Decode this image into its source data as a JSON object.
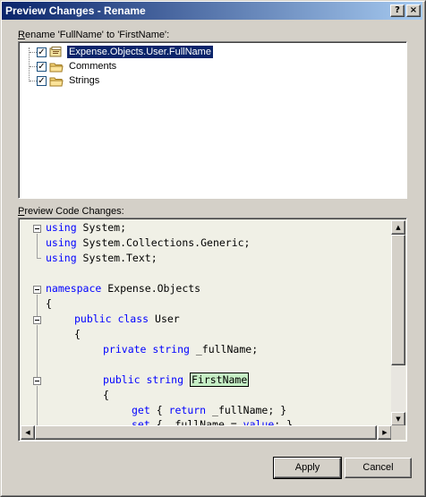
{
  "window": {
    "title": "Preview Changes - Rename",
    "help_label": "?",
    "close_label": "×"
  },
  "rename": {
    "label_accel": "R",
    "label_rest": "ename 'FullName' to 'FirstName':",
    "items": [
      {
        "label": "Expense.Objects.User.FullName",
        "checked": true,
        "icon": "class-file-icon",
        "selected": true
      },
      {
        "label": "Comments",
        "checked": true,
        "icon": "folder-icon",
        "selected": false
      },
      {
        "label": "Strings",
        "checked": true,
        "icon": "folder-icon",
        "selected": false
      }
    ]
  },
  "preview": {
    "label_accel": "P",
    "label_rest": "review Code Changes:",
    "code": {
      "line1_kw": "using",
      "line1_rest": " System;",
      "line2_kw": "using",
      "line2_rest": " System.Collections.Generic;",
      "line3_kw": "using",
      "line3_rest": " System.Text;",
      "line5_kw": "namespace",
      "line5_rest": " Expense.Objects",
      "line6": "{",
      "line7_kw": "public class",
      "line7_rest": " User",
      "line8": "{",
      "line9_kw1": "private",
      "line9_kw2": "string",
      "line9_rest": " _fullName;",
      "line11_kw1": "public",
      "line11_kw2": "string",
      "line11_hl": "FirstName",
      "line12": "{",
      "line13_kw1": "get",
      "line13_mid": " { ",
      "line13_kw2": "return",
      "line13_rest": " _fullName; }",
      "line14_kw1": "set",
      "line14_mid": " { _fullName = ",
      "line14_kw2": "value",
      "line14_rest": "; }"
    }
  },
  "buttons": {
    "apply": "Apply",
    "cancel": "Cancel"
  },
  "colors": {
    "keyword": "#0000ff",
    "highlight": "#c6efc6",
    "titlebar_start": "#0a246a",
    "titlebar_end": "#a6caf0"
  }
}
